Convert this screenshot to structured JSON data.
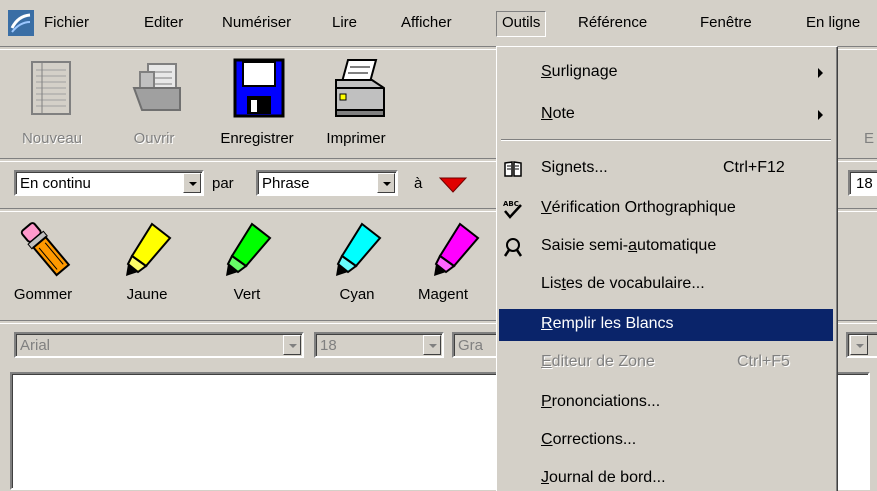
{
  "menubar": {
    "items": [
      "Fichier",
      "Editer",
      "Numériser",
      "Lire",
      "Afficher",
      "Outils",
      "Référence",
      "Fenêtre",
      "En ligne"
    ]
  },
  "toolbar": {
    "buttons": [
      {
        "label": "Nouveau",
        "icon": "notebook-icon",
        "enabled": false
      },
      {
        "label": "Ouvrir",
        "icon": "open-folder-icon",
        "enabled": false
      },
      {
        "label": "Enregistrer",
        "icon": "floppy-disk-icon",
        "enabled": true
      },
      {
        "label": "Imprimer",
        "icon": "printer-icon",
        "enabled": true
      }
    ],
    "partial_label": "E"
  },
  "reading": {
    "mode_value": "En continu",
    "par_label": "par",
    "unit_value": "Phrase",
    "a_label": "à",
    "speed_partial": "18"
  },
  "highlighters": [
    {
      "label": "Gommer",
      "icon": "eraser-icon"
    },
    {
      "label": "Jaune",
      "icon": "yellow-highlighter-icon",
      "color": "#ffff00"
    },
    {
      "label": "Vert",
      "icon": "green-highlighter-icon",
      "color": "#00ff00"
    },
    {
      "label": "Cyan",
      "icon": "cyan-highlighter-icon",
      "color": "#00ffff"
    },
    {
      "label": "Magent",
      "icon": "magenta-highlighter-icon",
      "color": "#ff00ff"
    }
  ],
  "format": {
    "font_value": "Arial",
    "size_value": "18",
    "style_partial": "Gra"
  },
  "outils_menu": {
    "items": [
      {
        "label": "Surlignage",
        "underline": "S",
        "rest": "urlignage",
        "submenu": true
      },
      {
        "label": "Note",
        "underline": "N",
        "rest": "ote",
        "submenu": true
      },
      {
        "label": "Signets...",
        "shortcut": "Ctrl+F12",
        "icon": "book-icon"
      },
      {
        "label": "Vérification Orthographique",
        "underline": "V",
        "rest": "érification Orthographique",
        "icon": "spell-check-icon"
      },
      {
        "label": "Saisie semi-automatique",
        "pre": "Saisie semi-",
        "underline": "a",
        "rest": "utomatique",
        "icon": "magnifier-icon"
      },
      {
        "label": "Listes de vocabulaire...",
        "pre": "Lis",
        "underline": "t",
        "rest": "es de vocabulaire..."
      },
      {
        "label": "Remplir les Blancs",
        "underline": "R",
        "rest": "emplir les Blancs",
        "highlighted": true
      },
      {
        "label": "Editeur de Zone",
        "underline": "E",
        "rest": "diteur de Zone",
        "shortcut": "Ctrl+F5",
        "disabled": true
      },
      {
        "label": "Prononciations...",
        "underline": "P",
        "rest": "rononciations..."
      },
      {
        "label": "Corrections...",
        "underline": "C",
        "rest": "orrections..."
      },
      {
        "label": "Journal de bord...",
        "underline": "J",
        "rest": "ournal de bord..."
      }
    ]
  },
  "colors": {
    "face": "#d4d0c8",
    "highlight": "#0a246a",
    "floppy": "#0000ff"
  }
}
